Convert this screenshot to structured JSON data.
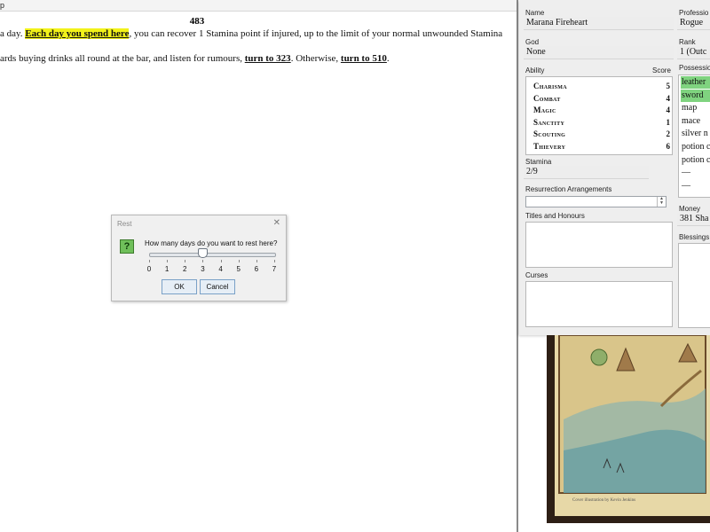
{
  "menubar": {
    "text": "p"
  },
  "story": {
    "section_number": "483",
    "para1": {
      "before": "a day. ",
      "highlight": "Each day you spend here",
      "after": ", you can recover 1 Stamina point if injured, up to the limit of your normal unwounded Stamina"
    },
    "para2": {
      "before": "ards buying drinks all round at the bar, and listen for rumours, ",
      "link1": "turn to 323",
      "middle": ". Otherwise, ",
      "link2": "turn to 510",
      "after": "."
    }
  },
  "dialog": {
    "title": "Rest",
    "question": "How many days do you want to rest here?",
    "slider": {
      "min": 0,
      "max": 7,
      "value": 3,
      "ticks": [
        "0",
        "1",
        "2",
        "3",
        "4",
        "5",
        "6",
        "7"
      ]
    },
    "ok_label": "OK",
    "cancel_label": "Cancel"
  },
  "character": {
    "name_label": "Name",
    "name": "Marana Fireheart",
    "profession_label": "Professio",
    "profession": "Rogue",
    "god_label": "God",
    "god": "None",
    "rank_label": "Rank",
    "rank": "1 (Outc",
    "ability_label": "Ability",
    "score_label": "Score",
    "abilities": [
      {
        "name": "Charisma",
        "score": "5"
      },
      {
        "name": "Combat",
        "score": "4"
      },
      {
        "name": "Magic",
        "score": "4"
      },
      {
        "name": "Sanctity",
        "score": "1"
      },
      {
        "name": "Scouting",
        "score": "2"
      },
      {
        "name": "Thievery",
        "score": "6"
      }
    ],
    "possessions_label": "Possessio",
    "possessions": [
      "leather",
      "sword",
      "map",
      "mace",
      "silver n",
      "potion c",
      "potion c",
      "—",
      "—"
    ],
    "stamina_label": "Stamina",
    "stamina": "2/9",
    "money_label": "Money",
    "money": "381 Sha",
    "resurrection_label": "Resurrection Arrangements",
    "titles_label": "Titles and Honours",
    "blessings_label": "Blessings",
    "curses_label": "Curses"
  },
  "map": {
    "credit": "Cover illustration by Kevin Jenkins"
  }
}
